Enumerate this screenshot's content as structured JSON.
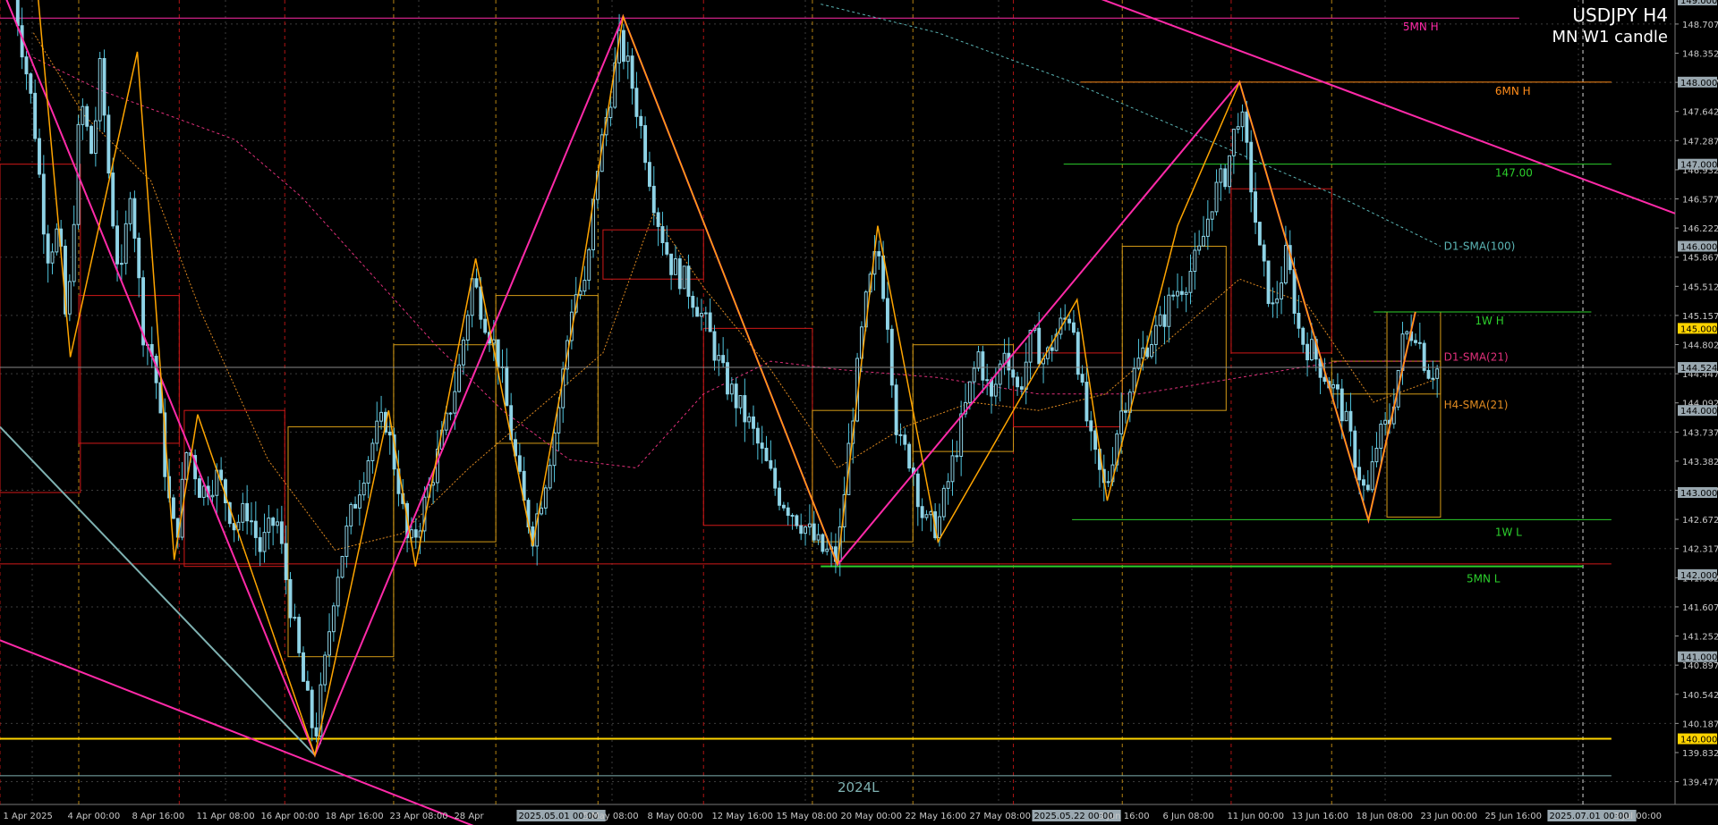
{
  "window": {
    "symbol_title": "USDJPY H4",
    "candle_mode": "MN W1 candle"
  },
  "colors": {
    "background": "#000000",
    "candle_body": "#8fd3e6",
    "candle_wick": "#4fc3dc",
    "grid": "#3c3c3c",
    "zigzag_pink": "#ff2aa8",
    "zigzag_orange": "#ffa500",
    "level_line": "#ffd400",
    "support_green": "#2ccf2c",
    "resistance_orange": "#ff8c1a",
    "box_red": "#d01818",
    "box_orange": "#d49a16",
    "sma_d1_100": "#5bb5b5",
    "sma_d1_21": "#e0307a",
    "sma_h4_21": "#e08a20",
    "trend_teal": "#7fb2b2",
    "price_axis_bg": "#9aa8b0",
    "price_axis_text": "#000000"
  },
  "chart_data": {
    "type": "candlestick",
    "symbol": "USDJPY",
    "timeframe": "H4",
    "ylim": [
      139.2,
      149.0
    ],
    "y_ticks": [
      148.707,
      148.352,
      147.997,
      147.642,
      147.287,
      146.932,
      146.577,
      146.222,
      145.867,
      145.512,
      145.157,
      144.802,
      144.447,
      144.092,
      143.737,
      143.382,
      143.027,
      142.672,
      142.317,
      141.962,
      141.607,
      141.252,
      140.897,
      140.542,
      140.187,
      139.832,
      139.477
    ],
    "x_labels": [
      "1 Apr 2025",
      "4 Apr 00:00",
      "8 Apr 16:00",
      "11 Apr 08:00",
      "16 Apr 00:00",
      "18 Apr 16:00",
      "23 Apr 08:00",
      "28 Apr",
      "2025.05.01 00:00",
      "5 May 08:00",
      "8 May 00:00",
      "12 May 16:00",
      "15 May 08:00",
      "20 May 00:00",
      "22 May 16:00",
      "27 May 08:00",
      "2025.05.22 00:00",
      "3 Jun 16:00",
      "6 Jun 08:00",
      "11 Jun 00:00",
      "13 Jun 16:00",
      "18 Jun 08:00",
      "23 Jun 00:00",
      "25 Jun 16:00",
      "2025.07.01 00:00",
      "3 Jul 00:00"
    ],
    "current_price": 144.524,
    "price_tags": [
      {
        "label": "149.000",
        "value": 149.0,
        "color": "#9aa8b0"
      },
      {
        "label": "148.000",
        "value": 148.0,
        "color": "#9aa8b0"
      },
      {
        "label": "147.000",
        "value": 147.0,
        "color": "#9aa8b0"
      },
      {
        "label": "146.000",
        "value": 146.0,
        "color": "#9aa8b0"
      },
      {
        "label": "145.000",
        "value": 145.0,
        "color": "#ffd400"
      },
      {
        "label": "144.524",
        "value": 144.524,
        "color": "#9aa8b0"
      },
      {
        "label": "144.000",
        "value": 144.0,
        "color": "#9aa8b0"
      },
      {
        "label": "143.000",
        "value": 143.0,
        "color": "#9aa8b0"
      },
      {
        "label": "142.000",
        "value": 142.0,
        "color": "#9aa8b0"
      },
      {
        "label": "141.000",
        "value": 141.0,
        "color": "#9aa8b0"
      },
      {
        "label": "140.000",
        "value": 140.0,
        "color": "#ffd400"
      }
    ],
    "levels": [
      {
        "label": "5MN H",
        "value": 148.78,
        "color": "#ff2aa8",
        "x_from": 0.0,
        "x_to": 0.907
      },
      {
        "label": "6MN H",
        "value": 148.0,
        "color": "#ff8c1a",
        "x_from": 0.645,
        "x_to": 0.962
      },
      {
        "label": "147.00",
        "value": 147.0,
        "color": "#2ccf2c",
        "x_from": 0.635,
        "x_to": 0.962
      },
      {
        "label": "1W H",
        "value": 145.2,
        "color": "#2ccf2c",
        "x_from": 0.82,
        "x_to": 0.95
      },
      {
        "label": "1W L",
        "value": 142.67,
        "color": "#2ccf2c",
        "x_from": 0.64,
        "x_to": 0.962
      },
      {
        "label": "5MN L",
        "value": 142.1,
        "color": "#2ccf2c",
        "x_from": 0.49,
        "x_to": 0.945
      },
      {
        "label": "2024L",
        "value": 139.55,
        "color": "#7fb2b2",
        "x_from": 0.0,
        "x_to": 0.962
      },
      {
        "label": "",
        "value": 140.0,
        "color": "#ffd400",
        "x_from": 0.0,
        "x_to": 0.962
      },
      {
        "label": "",
        "value": 142.13,
        "color": "#d01818",
        "x_from": 0.0,
        "x_to": 0.962
      }
    ],
    "indicator_labels": [
      {
        "label": "D1-SMA(100)",
        "value": 146.0,
        "color": "#5bb5b5"
      },
      {
        "label": "D1-SMA(21)",
        "value": 144.65,
        "color": "#e0307a"
      },
      {
        "label": "H4-SMA(21)",
        "value": 144.07,
        "color": "#e08a20"
      }
    ],
    "zigzag_pink": [
      [
        0.0,
        149.2
      ],
      [
        0.188,
        139.8
      ],
      [
        0.372,
        148.8
      ],
      [
        0.5,
        142.12
      ],
      [
        0.74,
        148.0
      ],
      [
        0.817,
        142.66
      ],
      [
        0.845,
        145.2
      ]
    ],
    "zigzag_orange": [
      [
        0.022,
        149.2
      ],
      [
        0.042,
        144.65
      ],
      [
        0.082,
        148.37
      ],
      [
        0.104,
        142.18
      ],
      [
        0.118,
        143.95
      ],
      [
        0.188,
        139.8
      ],
      [
        0.232,
        144.0
      ],
      [
        0.248,
        142.1
      ],
      [
        0.284,
        145.85
      ],
      [
        0.318,
        142.35
      ],
      [
        0.346,
        145.5
      ],
      [
        0.372,
        148.8
      ],
      [
        0.5,
        142.12
      ],
      [
        0.524,
        146.25
      ],
      [
        0.56,
        142.4
      ],
      [
        0.643,
        145.35
      ],
      [
        0.661,
        142.9
      ],
      [
        0.703,
        146.25
      ],
      [
        0.74,
        148.0
      ],
      [
        0.817,
        142.66
      ],
      [
        0.845,
        145.2
      ]
    ],
    "price_path": [
      [
        0.008,
        149.1
      ],
      [
        0.02,
        147.6
      ],
      [
        0.028,
        145.9
      ],
      [
        0.035,
        146.2
      ],
      [
        0.04,
        144.9
      ],
      [
        0.048,
        147.8
      ],
      [
        0.055,
        147.1
      ],
      [
        0.06,
        148.2
      ],
      [
        0.066,
        146.6
      ],
      [
        0.072,
        145.5
      ],
      [
        0.078,
        146.8
      ],
      [
        0.085,
        145.0
      ],
      [
        0.092,
        144.6
      ],
      [
        0.1,
        143.0
      ],
      [
        0.105,
        142.4
      ],
      [
        0.112,
        143.6
      ],
      [
        0.12,
        143.0
      ],
      [
        0.13,
        143.2
      ],
      [
        0.14,
        142.6
      ],
      [
        0.148,
        142.8
      ],
      [
        0.155,
        142.3
      ],
      [
        0.165,
        142.7
      ],
      [
        0.172,
        141.8
      ],
      [
        0.18,
        140.8
      ],
      [
        0.188,
        140.0
      ],
      [
        0.194,
        140.9
      ],
      [
        0.2,
        141.9
      ],
      [
        0.208,
        142.6
      ],
      [
        0.216,
        143.2
      ],
      [
        0.224,
        143.7
      ],
      [
        0.23,
        143.9
      ],
      [
        0.238,
        143.1
      ],
      [
        0.244,
        142.3
      ],
      [
        0.25,
        142.6
      ],
      [
        0.258,
        143.2
      ],
      [
        0.266,
        143.8
      ],
      [
        0.274,
        144.5
      ],
      [
        0.282,
        145.6
      ],
      [
        0.29,
        145.1
      ],
      [
        0.298,
        144.6
      ],
      [
        0.306,
        143.6
      ],
      [
        0.312,
        142.9
      ],
      [
        0.318,
        142.5
      ],
      [
        0.326,
        143.2
      ],
      [
        0.334,
        144.1
      ],
      [
        0.342,
        145.4
      ],
      [
        0.35,
        145.5
      ],
      [
        0.356,
        146.9
      ],
      [
        0.364,
        147.8
      ],
      [
        0.37,
        148.5
      ],
      [
        0.376,
        148.1
      ],
      [
        0.384,
        147.3
      ],
      [
        0.392,
        146.4
      ],
      [
        0.4,
        145.8
      ],
      [
        0.408,
        145.6
      ],
      [
        0.416,
        145.3
      ],
      [
        0.424,
        144.9
      ],
      [
        0.432,
        144.4
      ],
      [
        0.44,
        144.1
      ],
      [
        0.448,
        143.8
      ],
      [
        0.456,
        143.4
      ],
      [
        0.464,
        143.0
      ],
      [
        0.472,
        142.8
      ],
      [
        0.48,
        142.6
      ],
      [
        0.49,
        142.3
      ],
      [
        0.5,
        142.2
      ],
      [
        0.508,
        143.8
      ],
      [
        0.516,
        145.2
      ],
      [
        0.524,
        146.0
      ],
      [
        0.53,
        145.1
      ],
      [
        0.536,
        143.6
      ],
      [
        0.544,
        143.4
      ],
      [
        0.552,
        142.6
      ],
      [
        0.56,
        142.6
      ],
      [
        0.568,
        143.3
      ],
      [
        0.576,
        144.0
      ],
      [
        0.584,
        144.7
      ],
      [
        0.592,
        144.1
      ],
      [
        0.6,
        144.8
      ],
      [
        0.608,
        144.2
      ],
      [
        0.616,
        144.9
      ],
      [
        0.624,
        144.6
      ],
      [
        0.632,
        145.0
      ],
      [
        0.64,
        145.2
      ],
      [
        0.646,
        144.2
      ],
      [
        0.652,
        143.5
      ],
      [
        0.66,
        143.0
      ],
      [
        0.668,
        143.9
      ],
      [
        0.676,
        144.4
      ],
      [
        0.684,
        144.8
      ],
      [
        0.692,
        145.0
      ],
      [
        0.7,
        145.4
      ],
      [
        0.708,
        145.6
      ],
      [
        0.716,
        145.9
      ],
      [
        0.724,
        146.6
      ],
      [
        0.732,
        146.9
      ],
      [
        0.74,
        147.7
      ],
      [
        0.746,
        146.9
      ],
      [
        0.752,
        145.9
      ],
      [
        0.76,
        145.2
      ],
      [
        0.768,
        145.9
      ],
      [
        0.776,
        144.9
      ],
      [
        0.784,
        144.7
      ],
      [
        0.792,
        144.4
      ],
      [
        0.8,
        144.1
      ],
      [
        0.808,
        143.5
      ],
      [
        0.816,
        142.9
      ],
      [
        0.822,
        143.6
      ],
      [
        0.83,
        143.9
      ],
      [
        0.838,
        144.9
      ],
      [
        0.845,
        145.0
      ],
      [
        0.852,
        144.5
      ],
      [
        0.858,
        144.5
      ]
    ],
    "sma_d1_100": [
      [
        0.49,
        148.95
      ],
      [
        0.56,
        148.6
      ],
      [
        0.64,
        148.0
      ],
      [
        0.72,
        147.3
      ],
      [
        0.8,
        146.6
      ],
      [
        0.86,
        146.0
      ]
    ],
    "sma_d1_21": [
      [
        0.02,
        148.3
      ],
      [
        0.06,
        147.9
      ],
      [
        0.1,
        147.6
      ],
      [
        0.14,
        147.3
      ],
      [
        0.18,
        146.6
      ],
      [
        0.22,
        145.7
      ],
      [
        0.26,
        144.8
      ],
      [
        0.3,
        144.0
      ],
      [
        0.34,
        143.4
      ],
      [
        0.38,
        143.3
      ],
      [
        0.42,
        144.2
      ],
      [
        0.46,
        144.6
      ],
      [
        0.5,
        144.5
      ],
      [
        0.56,
        144.4
      ],
      [
        0.62,
        144.2
      ],
      [
        0.68,
        144.2
      ],
      [
        0.74,
        144.4
      ],
      [
        0.8,
        144.6
      ],
      [
        0.86,
        144.6
      ]
    ],
    "sma_h4_21": [
      [
        0.02,
        148.6
      ],
      [
        0.05,
        147.6
      ],
      [
        0.09,
        146.8
      ],
      [
        0.12,
        145.2
      ],
      [
        0.16,
        143.4
      ],
      [
        0.2,
        142.3
      ],
      [
        0.24,
        142.5
      ],
      [
        0.28,
        143.3
      ],
      [
        0.32,
        144.0
      ],
      [
        0.36,
        144.7
      ],
      [
        0.39,
        146.4
      ],
      [
        0.42,
        145.5
      ],
      [
        0.46,
        144.5
      ],
      [
        0.5,
        143.3
      ],
      [
        0.54,
        143.8
      ],
      [
        0.58,
        144.1
      ],
      [
        0.62,
        144.0
      ],
      [
        0.66,
        144.2
      ],
      [
        0.7,
        144.9
      ],
      [
        0.74,
        145.6
      ],
      [
        0.78,
        145.3
      ],
      [
        0.82,
        144.1
      ],
      [
        0.86,
        144.4
      ]
    ],
    "trend_lines": [
      {
        "color": "#ff2aa8",
        "points": [
          [
            0.0,
            141.2
          ],
          [
            0.3,
            138.8
          ]
        ]
      },
      {
        "color": "#ff2aa8",
        "points": [
          [
            0.6,
            149.45
          ],
          [
            1.0,
            146.4
          ]
        ]
      },
      {
        "color": "#7fb2b2",
        "points": [
          [
            0.0,
            143.8
          ],
          [
            0.188,
            139.8
          ]
        ]
      }
    ],
    "boxes": [
      {
        "color": "#d01818",
        "x0": 0.0,
        "x1": 0.048,
        "y0": 147.0,
        "y1": 143.0
      },
      {
        "color": "#d01818",
        "x0": 0.047,
        "x1": 0.107,
        "y0": 145.4,
        "y1": 143.6
      },
      {
        "color": "#d01818",
        "x0": 0.11,
        "x1": 0.17,
        "y0": 144.0,
        "y1": 142.1
      },
      {
        "color": "#d49a16",
        "x0": 0.172,
        "x1": 0.235,
        "y0": 143.8,
        "y1": 141.0
      },
      {
        "color": "#d49a16",
        "x0": 0.235,
        "x1": 0.296,
        "y0": 144.8,
        "y1": 142.4
      },
      {
        "color": "#d49a16",
        "x0": 0.296,
        "x1": 0.357,
        "y0": 145.4,
        "y1": 143.6
      },
      {
        "color": "#d01818",
        "x0": 0.36,
        "x1": 0.42,
        "y0": 146.2,
        "y1": 145.6
      },
      {
        "color": "#d01818",
        "x0": 0.42,
        "x1": 0.485,
        "y0": 145.0,
        "y1": 142.6
      },
      {
        "color": "#d49a16",
        "x0": 0.485,
        "x1": 0.545,
        "y0": 144.0,
        "y1": 142.4
      },
      {
        "color": "#d49a16",
        "x0": 0.545,
        "x1": 0.605,
        "y0": 144.8,
        "y1": 143.5
      },
      {
        "color": "#d01818",
        "x0": 0.605,
        "x1": 0.67,
        "y0": 144.7,
        "y1": 143.8
      },
      {
        "color": "#d49a16",
        "x0": 0.67,
        "x1": 0.732,
        "y0": 146.0,
        "y1": 144.0
      },
      {
        "color": "#d01818",
        "x0": 0.735,
        "x1": 0.795,
        "y0": 146.7,
        "y1": 144.7
      },
      {
        "color": "#d49a16",
        "x0": 0.795,
        "x1": 0.86,
        "y0": 144.6,
        "y1": 144.2
      },
      {
        "color": "#d49a16",
        "x0": 0.828,
        "x1": 0.86,
        "y0": 145.2,
        "y1": 142.7
      }
    ],
    "dashed_verticals": [
      {
        "x": 0.0,
        "color": "#d01818"
      },
      {
        "x": 0.047,
        "color": "#d49a16"
      },
      {
        "x": 0.107,
        "color": "#d01818"
      },
      {
        "x": 0.17,
        "color": "#d01818"
      },
      {
        "x": 0.235,
        "color": "#d49a16"
      },
      {
        "x": 0.296,
        "color": "#d49a16"
      },
      {
        "x": 0.357,
        "color": "#d49a16"
      },
      {
        "x": 0.42,
        "color": "#d01818"
      },
      {
        "x": 0.485,
        "color": "#d49a16"
      },
      {
        "x": 0.545,
        "color": "#d49a16"
      },
      {
        "x": 0.605,
        "color": "#d01818"
      },
      {
        "x": 0.67,
        "color": "#d49a16"
      },
      {
        "x": 0.735,
        "color": "#d01818"
      },
      {
        "x": 0.795,
        "color": "#d49a16"
      },
      {
        "x": 0.945,
        "color": "#ffffff"
      }
    ],
    "grid": true
  }
}
